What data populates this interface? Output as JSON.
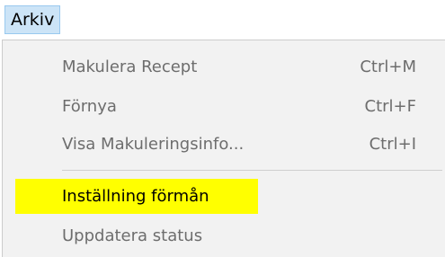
{
  "menubar": {
    "items": [
      {
        "label": "Arkiv"
      }
    ]
  },
  "menu": {
    "items": [
      {
        "label": "Makulera Recept",
        "shortcut": "Ctrl+M",
        "enabled": false
      },
      {
        "label": "Förnya",
        "shortcut": "Ctrl+F",
        "enabled": false
      },
      {
        "label": "Visa Makuleringsinfo...",
        "shortcut": "Ctrl+I",
        "enabled": false
      },
      {
        "label": "Inställning förmån",
        "shortcut": "",
        "enabled": true,
        "highlight_color": "#ffff00"
      },
      {
        "label": "Uppdatera status",
        "shortcut": "",
        "enabled": false
      }
    ]
  },
  "colors": {
    "menubar_active_bg": "#cce4f7",
    "menu_bg": "#f2f2f2",
    "disabled_text": "#6d6d6d",
    "highlight": "#ffff00"
  }
}
